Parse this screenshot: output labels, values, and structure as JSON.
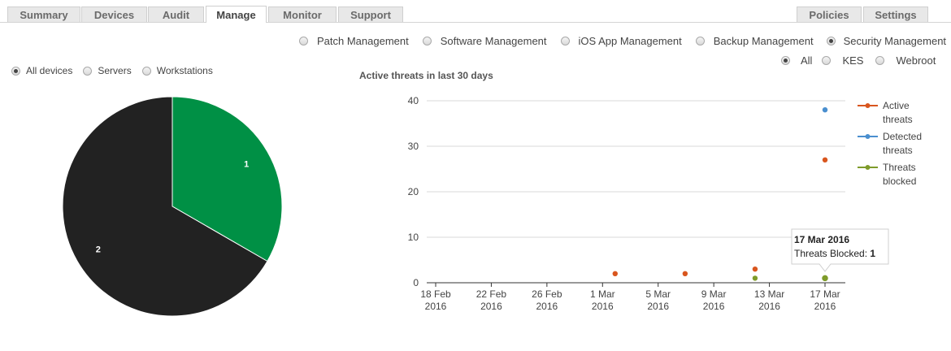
{
  "tabs_left": [
    {
      "label": "Summary",
      "active": false
    },
    {
      "label": "Devices",
      "active": false
    },
    {
      "label": "Audit",
      "active": false
    },
    {
      "label": "Manage",
      "active": true
    },
    {
      "label": "Monitor",
      "active": false
    },
    {
      "label": "Support",
      "active": false
    }
  ],
  "tabs_right": [
    {
      "label": "Policies",
      "active": false
    },
    {
      "label": "Settings",
      "active": false
    }
  ],
  "management_options": [
    {
      "label": "Patch Management",
      "selected": false
    },
    {
      "label": "Software Management",
      "selected": false
    },
    {
      "label": "iOS App Management",
      "selected": false
    },
    {
      "label": "Backup Management",
      "selected": false
    },
    {
      "label": "Security Management",
      "selected": true
    }
  ],
  "vendor_options": [
    {
      "label": "All",
      "selected": true
    },
    {
      "label": "KES",
      "selected": false
    },
    {
      "label": "Webroot",
      "selected": false
    }
  ],
  "device_options": [
    {
      "label": "All devices",
      "selected": true
    },
    {
      "label": "Servers",
      "selected": false
    },
    {
      "label": "Workstations",
      "selected": false
    }
  ],
  "chart_data": [
    {
      "type": "pie",
      "slices": [
        {
          "label": "1",
          "value": 1,
          "color": "#009045"
        },
        {
          "label": "2",
          "value": 2,
          "color": "#222222"
        }
      ]
    },
    {
      "type": "scatter",
      "title": "Active threats in last 30 days",
      "x_tick_labels": [
        [
          "18 Feb",
          "2016"
        ],
        [
          "22 Feb",
          "2016"
        ],
        [
          "26 Feb",
          "2016"
        ],
        [
          "1 Mar",
          "2016"
        ],
        [
          "5 Mar",
          "2016"
        ],
        [
          "9 Mar",
          "2016"
        ],
        [
          "13 Mar",
          "2016"
        ],
        [
          "17 Mar",
          "2016"
        ]
      ],
      "xlim": [
        "2016-02-18",
        "2016-03-17"
      ],
      "ylim": [
        0,
        40
      ],
      "y_ticks": [
        0,
        10,
        20,
        30,
        40
      ],
      "grid": true,
      "legend_position": "right",
      "series": [
        {
          "name": [
            "Active",
            "threats"
          ],
          "color": "#d9561e",
          "points": [
            {
              "x": "2016-03-02",
              "y": 2
            },
            {
              "x": "2016-03-07",
              "y": 2
            },
            {
              "x": "2016-03-12",
              "y": 3
            },
            {
              "x": "2016-03-17",
              "y": 27
            }
          ]
        },
        {
          "name": [
            "Detected",
            "threats"
          ],
          "color": "#4a8fcf",
          "points": [
            {
              "x": "2016-03-17",
              "y": 38
            }
          ]
        },
        {
          "name": [
            "Threats",
            "blocked"
          ],
          "color": "#7e9b2a",
          "points": [
            {
              "x": "2016-03-12",
              "y": 1
            },
            {
              "x": "2016-03-17",
              "y": 1
            }
          ]
        }
      ],
      "tooltip": {
        "date": "17 Mar 2016",
        "label": "Threats Blocked:",
        "value": "1"
      }
    }
  ]
}
